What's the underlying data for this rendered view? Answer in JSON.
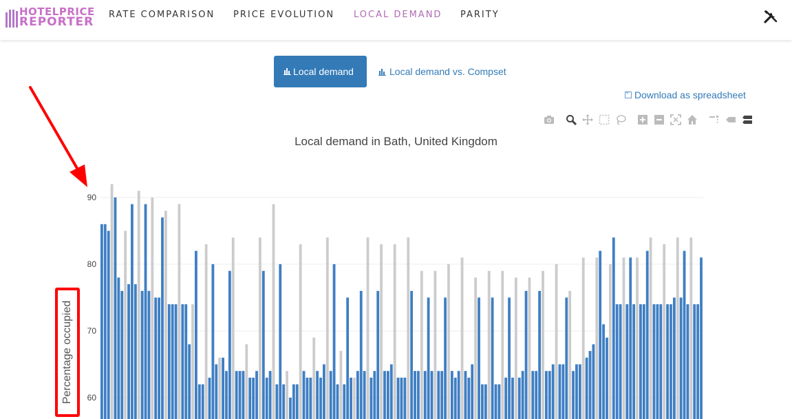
{
  "nav": {
    "logo_line1": "HOTELPRICE",
    "logo_line2": "REPORTER",
    "items": [
      {
        "label": "RATE COMPARISON",
        "active": false
      },
      {
        "label": "PRICE EVOLUTION",
        "active": false
      },
      {
        "label": "LOCAL DEMAND",
        "active": true
      },
      {
        "label": "PARITY",
        "active": false
      }
    ],
    "tools_icon": "tools-icon"
  },
  "tabs": {
    "local_demand": "Local demand",
    "local_demand_vs_compset": "Local demand vs. Compset"
  },
  "download_label": "Download as spreadsheet",
  "modebar_icons": [
    "camera-icon",
    "zoom-icon",
    "pan-icon",
    "box-select-icon",
    "lasso-icon",
    "zoom-in-icon",
    "zoom-out-icon",
    "autoscale-icon",
    "reset-axes-icon",
    "spike-lines-icon",
    "hover-closest-icon",
    "hover-compare-icon"
  ],
  "colors": {
    "brand": "#b06ab3",
    "primary": "#337ab7",
    "bar_blue": "#3f7fc4",
    "bar_grey": "#cccccc",
    "annotation": "#ff0000"
  },
  "chart_data": {
    "type": "bar",
    "title": "Local demand in Bath, United Kingdom",
    "ylabel": "Percentage occupied",
    "xlabel": "",
    "grid": true,
    "yticks": [
      60,
      70,
      80,
      90
    ],
    "ylim": [
      57,
      95
    ],
    "series": [
      {
        "values": [
          86,
          86,
          85,
          86,
          90,
          78,
          76,
          77,
          77,
          89,
          77,
          76,
          76,
          89,
          76,
          75,
          75,
          75,
          87,
          74,
          74,
          74,
          74,
          87,
          74,
          74,
          68,
          68,
          82,
          62,
          62,
          63,
          63,
          80,
          65,
          66,
          66,
          64,
          79,
          64,
          64,
          64,
          64,
          84,
          63,
          63,
          64,
          63,
          79,
          63,
          64,
          63,
          62,
          80,
          62,
          61,
          60,
          62,
          62,
          80,
          64,
          63,
          63,
          80,
          64,
          63,
          65,
          64,
          64,
          80,
          62,
          62,
          62,
          75,
          63,
          64,
          64,
          76,
          64,
          64,
          63,
          64,
          76,
          64,
          64,
          64,
          65,
          76,
          63,
          63,
          63,
          64,
          76,
          64,
          64,
          64,
          64,
          75,
          64,
          64,
          64,
          64,
          75,
          64,
          64,
          63,
          64,
          75,
          64,
          63,
          65,
          64,
          75,
          62,
          62,
          62,
          75,
          62,
          62,
          63,
          63,
          75,
          63,
          63,
          63,
          64,
          76,
          63,
          64,
          64,
          76,
          64,
          64,
          64,
          65,
          65,
          65,
          65,
          75,
          65,
          64,
          65,
          65,
          76,
          66,
          67,
          68,
          71,
          82,
          71,
          69,
          77,
          84,
          74,
          74,
          74,
          74,
          81,
          74,
          74,
          74,
          74,
          82,
          74,
          74,
          74,
          74,
          81,
          74,
          74,
          75,
          75,
          75,
          82,
          74,
          74,
          74,
          74,
          81
        ]
      },
      {
        "values": [
          92,
          85,
          91,
          90,
          88,
          89,
          74,
          83,
          66,
          84,
          68,
          84,
          89,
          64,
          83,
          69,
          84,
          67,
          63,
          84,
          83,
          83,
          84,
          79,
          79,
          80,
          81,
          78,
          79,
          79,
          78,
          78,
          79,
          80,
          76,
          81,
          81,
          80,
          81,
          81,
          84,
          83,
          84,
          84,
          84,
          84,
          84,
          84,
          84,
          84,
          84
        ]
      }
    ]
  }
}
